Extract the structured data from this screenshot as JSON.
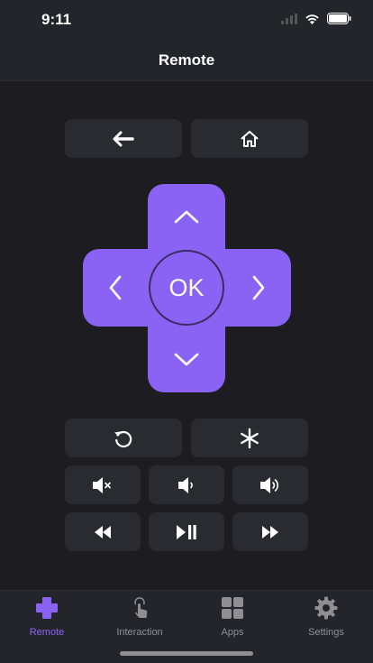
{
  "status": {
    "time": "9:11"
  },
  "nav": {
    "title": "Remote"
  },
  "remote": {
    "ok_label": "OK"
  },
  "tabs": [
    {
      "label": "Remote",
      "icon": "plus-cross-icon",
      "active": true
    },
    {
      "label": "Interaction",
      "icon": "touch-icon",
      "active": false
    },
    {
      "label": "Apps",
      "icon": "grid-icon",
      "active": false
    },
    {
      "label": "Settings",
      "icon": "gear-icon",
      "active": false
    }
  ],
  "colors": {
    "accent": "#8a63f5",
    "background": "#1c1c21",
    "button": "#2a2b31",
    "bar": "#24252b"
  }
}
